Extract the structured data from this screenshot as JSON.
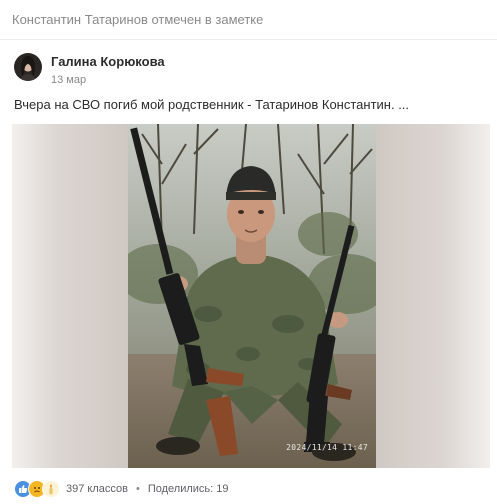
{
  "header": {
    "title": "Константин Татаринов отмечен в заметке"
  },
  "post": {
    "author": "Галина Корюкова",
    "date": "13 мар",
    "text": "Вчера на СВО погиб мой родственник  - Татаринов Константин. ...",
    "photo_timestamp": "2024/11/14 11:47"
  },
  "footer": {
    "reactions": [
      "like-icon",
      "sad-icon",
      "candle-icon"
    ],
    "classes_count": "397 классов",
    "separator": "•",
    "share_label": "Поделились: 19"
  },
  "colors": {
    "text_primary": "#2c2d2e",
    "text_secondary": "#8a8a8a",
    "like_reaction": "#4a90e2",
    "sad_reaction": "#f5b623",
    "candle_reaction": "#f7c55a"
  }
}
